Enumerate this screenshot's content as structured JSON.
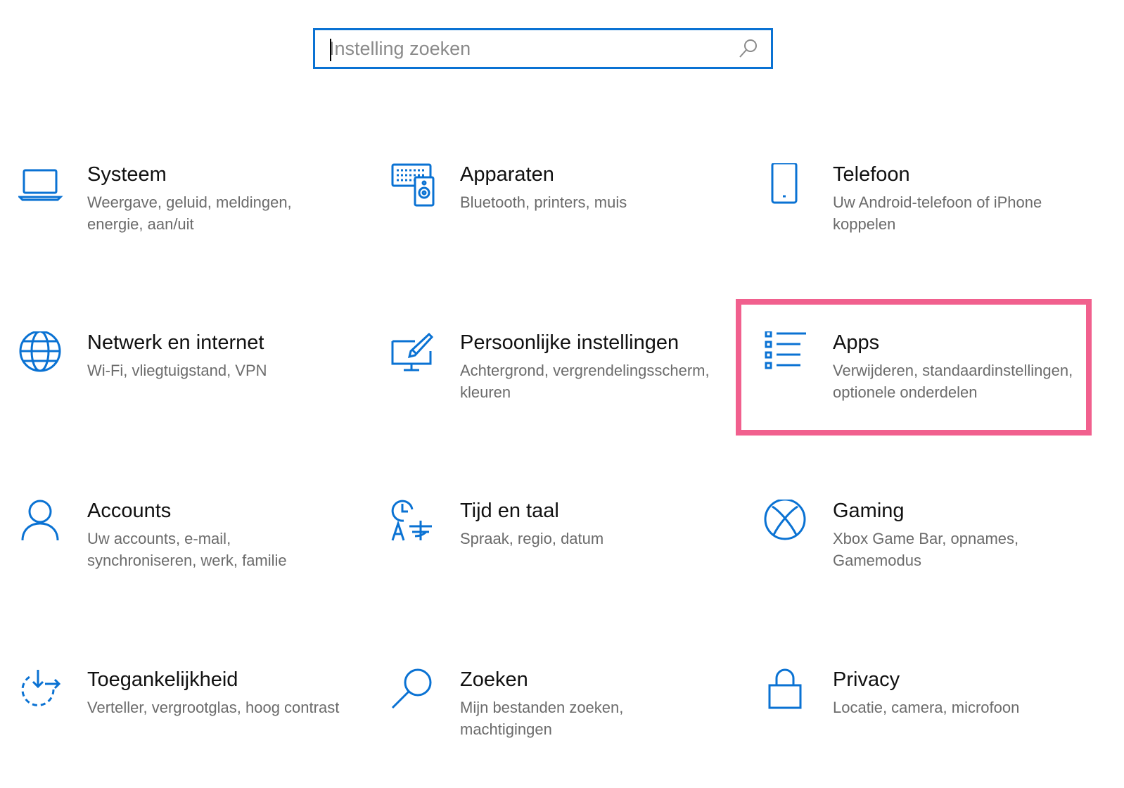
{
  "search": {
    "placeholder": "Instelling zoeken",
    "icon": "search-icon"
  },
  "accent_color": "#0a72d3",
  "highlight_color": "#f1608e",
  "tiles": [
    {
      "title": "Systeem",
      "desc": "Weergave, geluid, meldingen, energie, aan/uit",
      "icon": "laptop-icon"
    },
    {
      "title": "Apparaten",
      "desc": "Bluetooth, printers, muis",
      "icon": "devices-icon"
    },
    {
      "title": "Telefoon",
      "desc": "Uw Android-telefoon of iPhone koppelen",
      "icon": "phone-icon"
    },
    {
      "title": "Netwerk en internet",
      "desc": "Wi-Fi, vliegtuigstand, VPN",
      "icon": "globe-icon"
    },
    {
      "title": "Persoonlijke instellingen",
      "desc": "Achtergrond, vergrendelingsscherm, kleuren",
      "icon": "paint-icon"
    },
    {
      "title": "Apps",
      "desc": "Verwijderen, standaardinstellingen, optionele onderdelen",
      "icon": "apps-list-icon",
      "highlighted": true
    },
    {
      "title": "Accounts",
      "desc": "Uw accounts, e-mail, synchroniseren, werk, familie",
      "icon": "person-icon"
    },
    {
      "title": "Tijd en taal",
      "desc": "Spraak, regio, datum",
      "icon": "time-language-icon"
    },
    {
      "title": "Gaming",
      "desc": "Xbox Game Bar, opnames, Gamemodus",
      "icon": "xbox-icon"
    },
    {
      "title": "Toegankelijkheid",
      "desc": "Verteller, vergrootglas, hoog contrast",
      "icon": "accessibility-icon"
    },
    {
      "title": "Zoeken",
      "desc": "Mijn bestanden zoeken, machtigingen",
      "icon": "magnifier-icon"
    },
    {
      "title": "Privacy",
      "desc": "Locatie, camera, microfoon",
      "icon": "lock-icon"
    }
  ]
}
